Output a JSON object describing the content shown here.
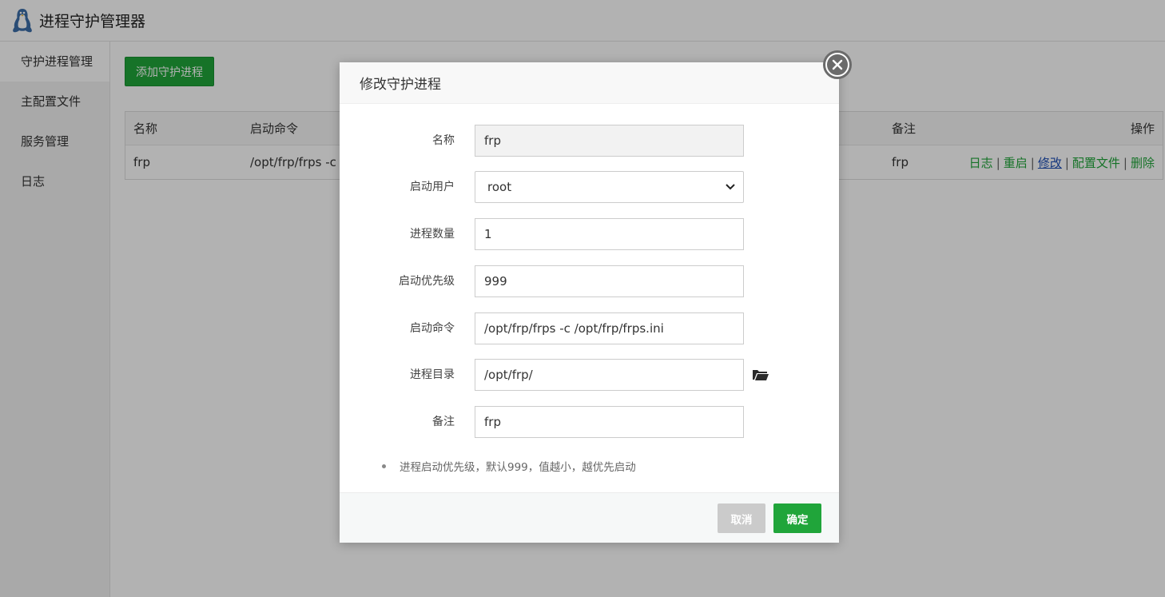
{
  "header": {
    "title": "进程守护管理器",
    "logo_icon": "linux-penguin-icon"
  },
  "sidebar": {
    "items": [
      {
        "label": "守护进程管理",
        "active": true
      },
      {
        "label": "主配置文件",
        "active": false
      },
      {
        "label": "服务管理",
        "active": false
      },
      {
        "label": "日志",
        "active": false
      }
    ]
  },
  "main": {
    "add_button": "添加守护进程",
    "table": {
      "headers": {
        "name": "名称",
        "command": "启动命令",
        "remark": "备注",
        "ops": "操作"
      },
      "rows": [
        {
          "name": "frp",
          "command": "/opt/frp/frps -c",
          "remark": "frp"
        }
      ],
      "ops": {
        "log": "日志",
        "restart": "重启",
        "edit": "修改",
        "config": "配置文件",
        "delete": "删除",
        "separator": "|"
      }
    }
  },
  "modal": {
    "title": "修改守护进程",
    "fields": {
      "name": {
        "label": "名称",
        "value": "frp"
      },
      "user": {
        "label": "启动用户",
        "value": "root"
      },
      "count": {
        "label": "进程数量",
        "value": "1"
      },
      "priority": {
        "label": "启动优先级",
        "value": "999"
      },
      "command": {
        "label": "启动命令",
        "value": "/opt/frp/frps -c /opt/frp/frps.ini"
      },
      "directory": {
        "label": "进程目录",
        "value": "/opt/frp/"
      },
      "remark": {
        "label": "备注",
        "value": "frp"
      }
    },
    "hint": "进程启动优先级，默认999，值越小，越优先启动",
    "cancel": "取消",
    "confirm": "确定"
  },
  "colors": {
    "accent": "#20a53a",
    "link_edit": "#1d4eb5",
    "cancel_bg": "#cbcbcb"
  }
}
